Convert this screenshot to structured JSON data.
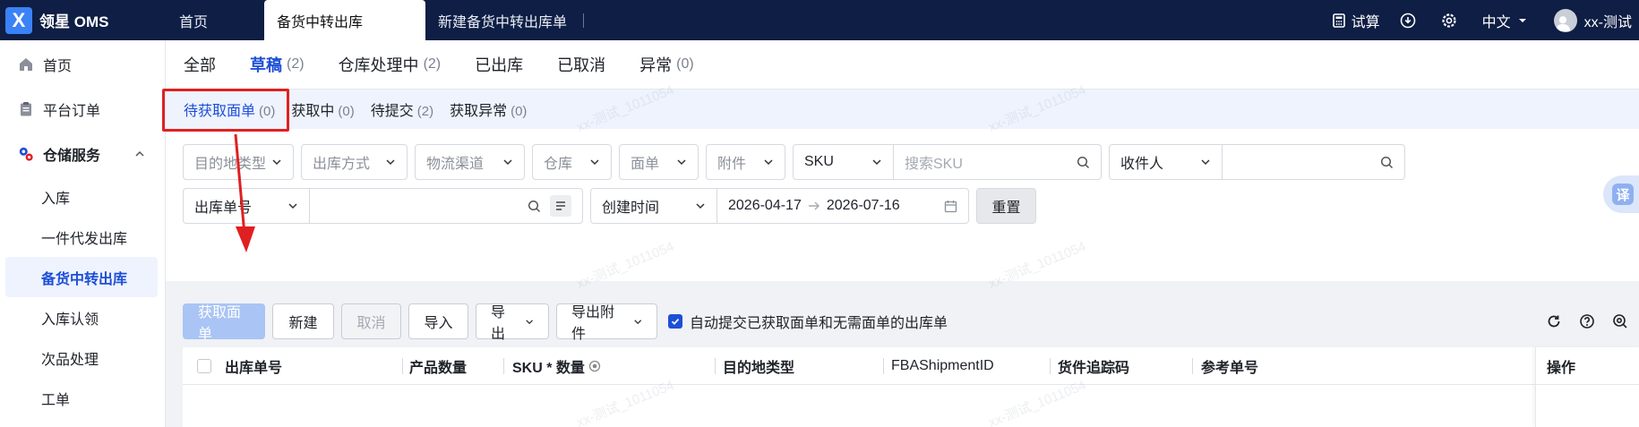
{
  "brand": {
    "logo_letter": "X",
    "name": "领星 OMS"
  },
  "top_tabs": [
    "首页",
    "备货中转出库",
    "新建备货中转出库单"
  ],
  "top_right": {
    "trial": "试算",
    "language": "中文",
    "user": "xx-测试"
  },
  "sidebar": {
    "items": [
      {
        "label": "首页"
      },
      {
        "label": "平台订单"
      },
      {
        "label": "仓储服务"
      }
    ],
    "sub_items": [
      "入库",
      "一件代发出库",
      "备货中转出库",
      "入库认领",
      "次品处理",
      "工单"
    ]
  },
  "status_tabs": [
    {
      "label": "全部",
      "count": ""
    },
    {
      "label": "草稿",
      "count": "(2)"
    },
    {
      "label": "仓库处理中",
      "count": "(2)"
    },
    {
      "label": "已出库",
      "count": ""
    },
    {
      "label": "已取消",
      "count": ""
    },
    {
      "label": "异常",
      "count": "(0)"
    }
  ],
  "sub_tabs": [
    {
      "label": "待获取面单",
      "count": "(0)"
    },
    {
      "label": "获取中",
      "count": "(0)"
    },
    {
      "label": "待提交",
      "count": "(2)"
    },
    {
      "label": "获取异常",
      "count": "(0)"
    }
  ],
  "filters": {
    "row1": [
      "目的地类型",
      "出库方式",
      "物流渠道",
      "仓库",
      "面单",
      "附件"
    ],
    "sku_select": "SKU",
    "sku_placeholder": "搜索SKU",
    "recipient_select": "收件人",
    "order_no_select": "出库单号",
    "time_select": "创建时间",
    "date_start": "2026-04-17",
    "date_end": "2026-07-16",
    "reset": "重置"
  },
  "toolbar": {
    "fetch_label": "获取面单",
    "new_label": "新建",
    "cancel_label": "取消",
    "import_label": "导入",
    "export_label": "导出",
    "export_attach_label": "导出附件",
    "auto_submit_label": "自动提交已获取面单和无需面单的出库单"
  },
  "table": {
    "columns": [
      "出库单号",
      "产品数量",
      "SKU * 数量",
      "目的地类型",
      "FBAShipmentID",
      "货件追踪码",
      "参考单号",
      "操作"
    ]
  },
  "watermark": "xx-测试_1011054",
  "translate": "译",
  "colors": {
    "topbar": "#0e1e44",
    "accent": "#1d4ed8",
    "highlight": "#e02020"
  }
}
